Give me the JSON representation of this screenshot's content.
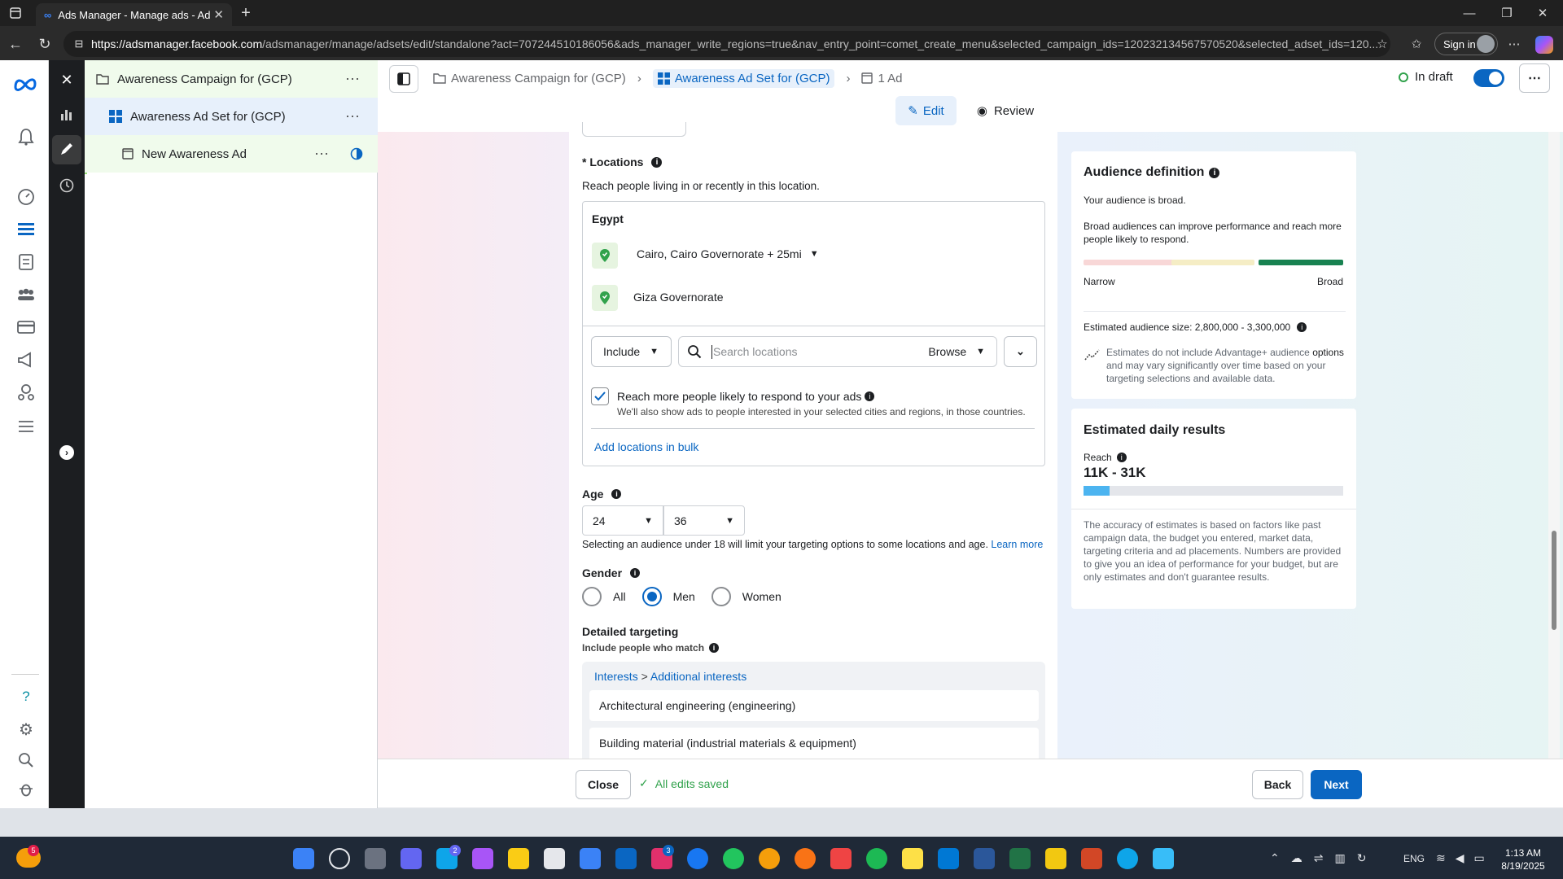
{
  "browser": {
    "tab_title": "Ads Manager - Manage ads - Ad",
    "url_domain": "https://adsmanager.facebook.com",
    "url_rest": "/adsmanager/manage/adsets/edit/standalone?act=707244510186056&ads_manager_write_regions=true&nav_entry_point=comet_create_menu&selected_campaign_ids=120232134567570520&selected_adset_ids=120...",
    "signin": "Sign in"
  },
  "tree": {
    "campaign": "Awareness Campaign for (GCP)",
    "adset": "Awareness Ad Set for (GCP)",
    "ad": "New Awareness Ad"
  },
  "breadcrumb": {
    "campaign": "Awareness Campaign for (GCP)",
    "adset": "Awareness Ad Set for (GCP)",
    "ad": "1 Ad",
    "status": "In draft"
  },
  "modes": {
    "edit": "Edit",
    "review": "Review"
  },
  "locations": {
    "title": "Locations",
    "required_mark": "*",
    "desc": "Reach people living in or recently in this location.",
    "country": "Egypt",
    "items": [
      "Cairo, Cairo Governorate + 25mi",
      "Giza Governorate"
    ],
    "include": "Include",
    "search_placeholder": "Search locations",
    "browse": "Browse",
    "reach_more": "Reach more people likely to respond to your ads",
    "reach_more_sub": "We'll also show ads to people interested in your selected cities and regions, in those countries.",
    "bulk": "Add locations in bulk"
  },
  "age": {
    "title": "Age",
    "min": "24",
    "max": "36",
    "note": "Selecting an audience under 18 will limit your targeting options to some locations and age.",
    "learn_more": "Learn more"
  },
  "gender": {
    "title": "Gender",
    "options": [
      "All",
      "Men",
      "Women"
    ],
    "selected": "Men"
  },
  "detailed": {
    "title": "Detailed targeting",
    "sub": "Include people who match",
    "path_a": "Interests",
    "path_sep": ">",
    "path_b": "Additional interests",
    "items": [
      "Architectural engineering (engineering)",
      "Building material (industrial materials & equipment)"
    ]
  },
  "audience": {
    "title": "Audience definition",
    "broad": "Your audience is broad.",
    "desc": "Broad audiences can improve performance and reach more people likely to respond.",
    "narrow": "Narrow",
    "broad_label": "Broad",
    "size": "Estimated audience size: 2,800,000 - 3,300,000",
    "note_a": "Estimates do not include Advantage+ audience",
    "note_b": "options",
    "note_c": "and may vary significantly over time based on your targeting selections and available data."
  },
  "daily": {
    "title": "Estimated daily results",
    "reach_label": "Reach",
    "reach": "11K - 31K",
    "reach_fill": 0.1,
    "note": "The accuracy of estimates is based on factors like past campaign data, the budget you entered, market data, targeting criteria and ad placements. Numbers are provided to give you an idea of performance for your budget, but are only estimates and don't guarantee results."
  },
  "footer": {
    "close": "Close",
    "saved": "All edits saved",
    "back": "Back",
    "next": "Next"
  },
  "taskbar": {
    "lang": "ENG",
    "time": "1:13 AM",
    "date": "8/19/2025",
    "badge_teams": "2",
    "badge_linkedin": "3",
    "badge_weather": "5"
  },
  "colors": {
    "accent": "#0a66c2",
    "broad_green": "#188251",
    "reach_blue": "#4cb4f0"
  }
}
